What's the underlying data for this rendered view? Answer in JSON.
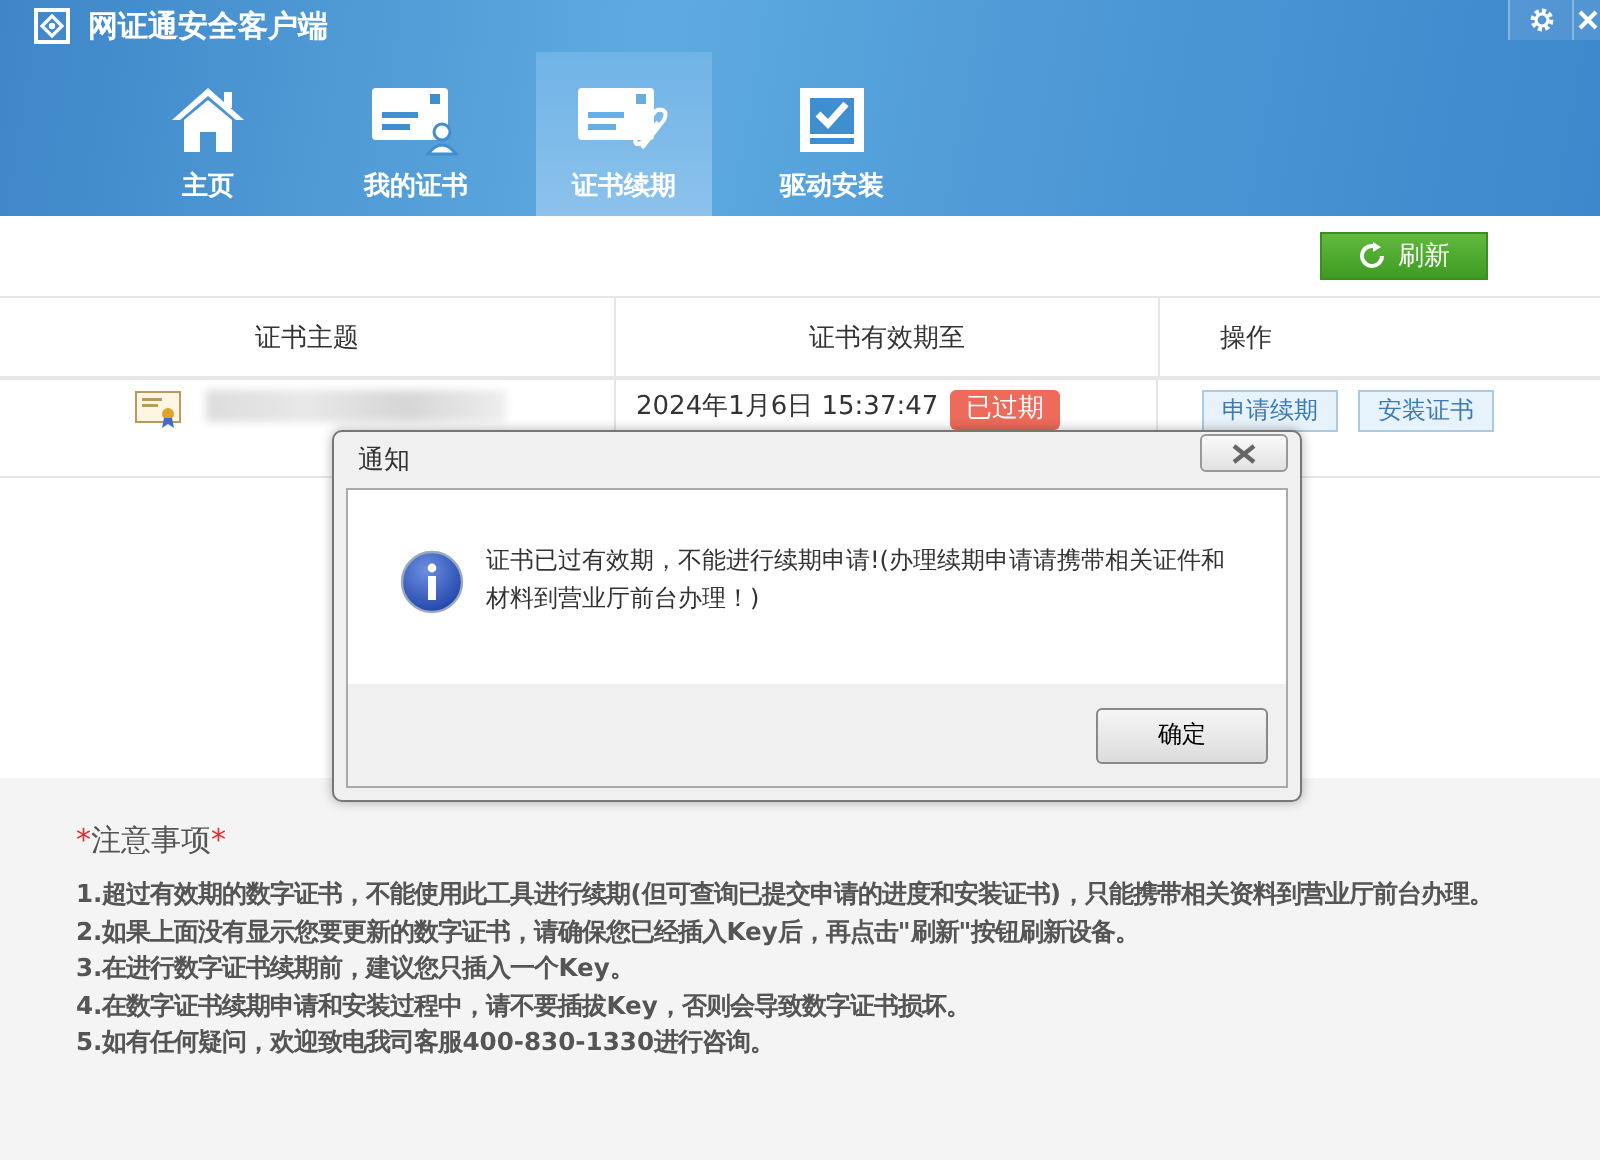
{
  "window": {
    "title": "网证通安全客户端"
  },
  "tabs": [
    {
      "label": "主页",
      "selected": false
    },
    {
      "label": "我的证书",
      "selected": false
    },
    {
      "label": "证书续期",
      "selected": true
    },
    {
      "label": "驱动安装",
      "selected": false
    }
  ],
  "toolbar": {
    "refresh_button": "刷新"
  },
  "table": {
    "columns": [
      "证书主题",
      "证书有效期至",
      "操作"
    ],
    "rows": [
      {
        "expiry": "2024年1月6日 15:37:47",
        "status": "已过期",
        "actions": [
          "申请续期",
          "安装证书"
        ]
      }
    ]
  },
  "notes": {
    "title_prefix": "*",
    "title": "注意事项",
    "title_suffix": "*",
    "items": [
      "1.超过有效期的数字证书，不能使用此工具进行续期(但可查询已提交申请的进度和安装证书)，只能携带相关资料到营业厅前台办理。",
      "2.如果上面没有显示您要更新的数字证书，请确保您已经插入Key后，再点击\"刷新\"按钮刷新设备。",
      "3.在进行数字证书续期前，建议您只插入一个Key。",
      "4.在数字证书续期申请和安装过程中，请不要插拔Key，否则会导致数字证书损坏。",
      "5.如有任何疑问，欢迎致电我司客服400-830-1330进行咨询。"
    ]
  },
  "dialog": {
    "title": "通知",
    "message": "证书已过有效期，不能进行续期申请!(办理续期申请请携带相关证件和材料到营业厅前台办理！)",
    "ok_button": "确定"
  }
}
